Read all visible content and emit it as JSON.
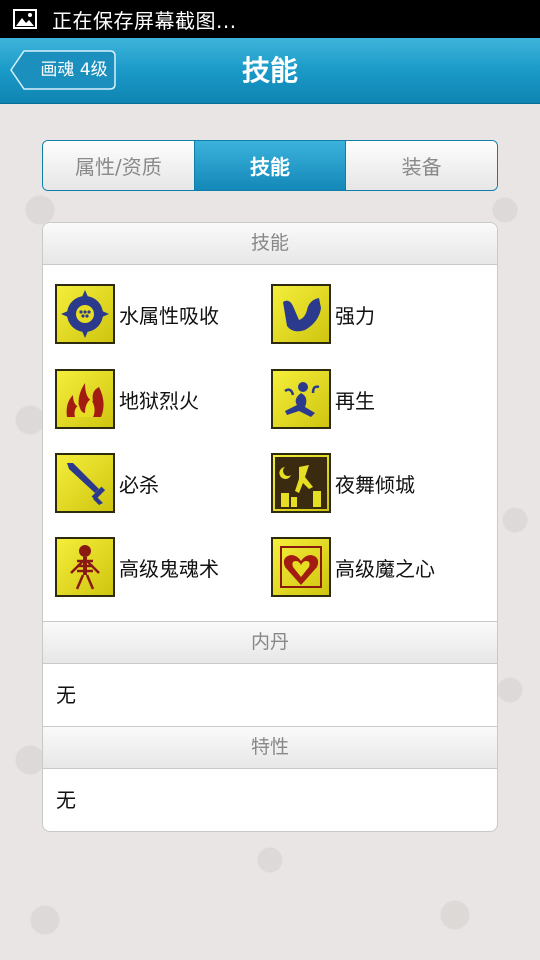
{
  "status_bar": {
    "text": "正在保存屏幕截图...",
    "icon": "image-icon"
  },
  "header": {
    "back_label": "画魂 4级",
    "title": "技能"
  },
  "tabs": [
    {
      "label": "属性/资质",
      "active": false
    },
    {
      "label": "技能",
      "active": true
    },
    {
      "label": "装备",
      "active": false
    }
  ],
  "skills_section": {
    "title": "技能",
    "skills": [
      {
        "name": "水属性吸收",
        "icon": "water-absorb-icon"
      },
      {
        "name": "强力",
        "icon": "strength-arm-icon"
      },
      {
        "name": "地狱烈火",
        "icon": "hellfire-icon"
      },
      {
        "name": "再生",
        "icon": "regeneration-icon"
      },
      {
        "name": "必杀",
        "icon": "sword-icon"
      },
      {
        "name": "夜舞倾城",
        "icon": "night-dance-icon"
      },
      {
        "name": "高级鬼魂术",
        "icon": "skeleton-icon"
      },
      {
        "name": "高级魔之心",
        "icon": "demon-heart-icon"
      }
    ]
  },
  "inner_dan_section": {
    "title": "内丹",
    "value": "无"
  },
  "traits_section": {
    "title": "特性",
    "value": "无"
  },
  "colors": {
    "accent": "#1a9ac8",
    "skill_icon_bg": "#e6de22"
  }
}
